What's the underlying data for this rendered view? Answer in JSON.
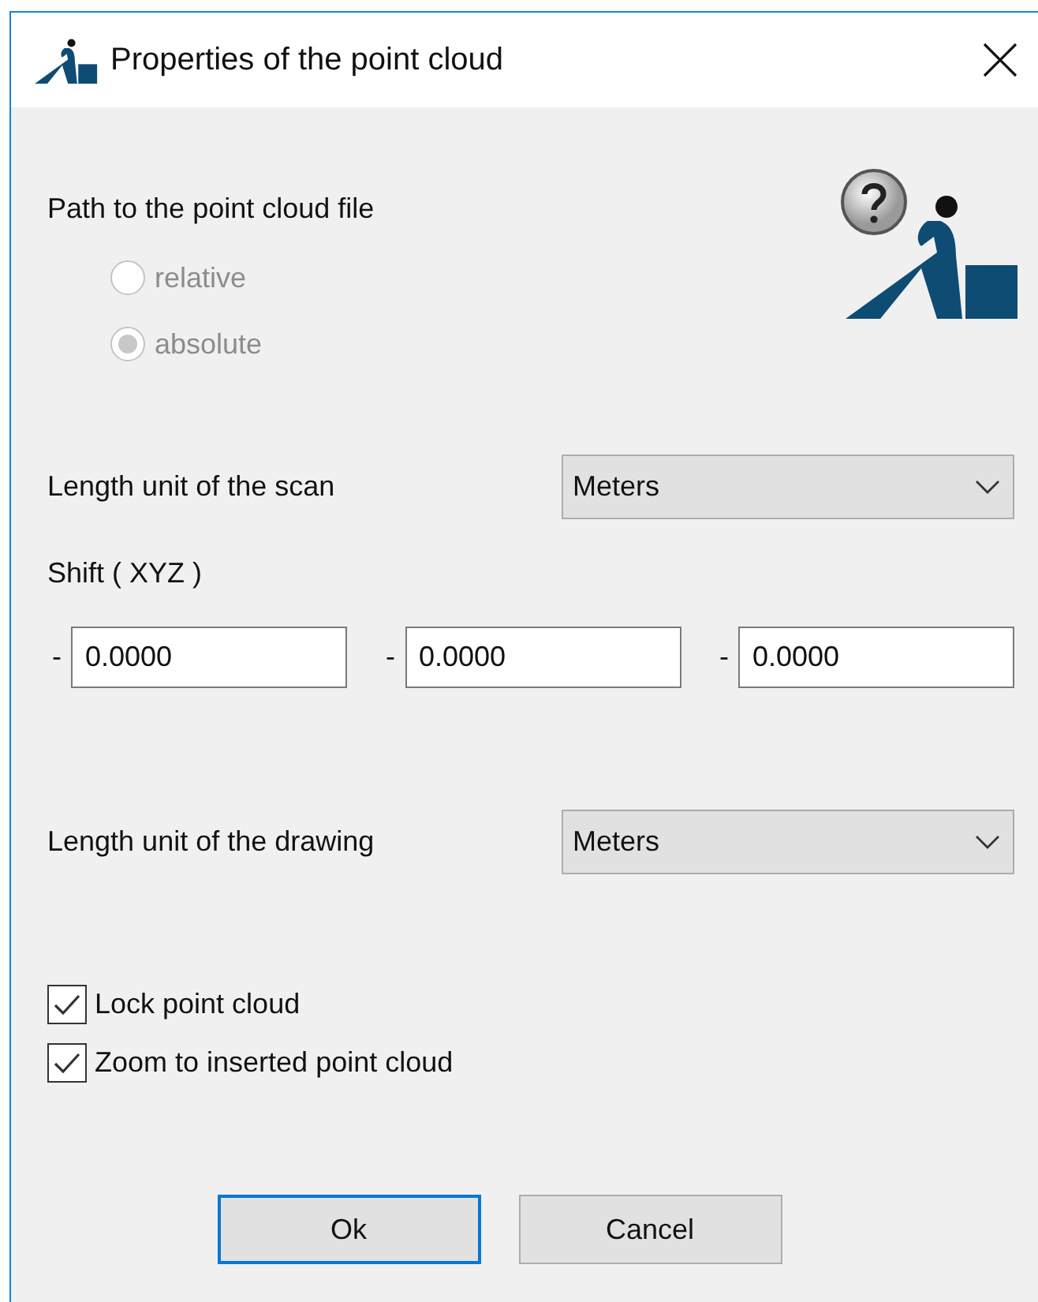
{
  "window": {
    "title": "Properties of the point cloud"
  },
  "path": {
    "label": "Path to the point cloud file",
    "options": [
      {
        "label": "relative",
        "selected": false,
        "disabled": true
      },
      {
        "label": "absolute",
        "selected": true,
        "disabled": true
      }
    ]
  },
  "scan_unit": {
    "label": "Length unit of the scan",
    "value": "Meters"
  },
  "shift": {
    "label": "Shift ( XYZ )",
    "fields": [
      {
        "prefix": "-",
        "value": "0.0000"
      },
      {
        "prefix": "-",
        "value": "0.0000"
      },
      {
        "prefix": "-",
        "value": "0.0000"
      }
    ]
  },
  "drawing_unit": {
    "label": "Length unit of the drawing",
    "value": "Meters"
  },
  "checkboxes": [
    {
      "label": "Lock point cloud",
      "checked": true
    },
    {
      "label": "Zoom to inserted point cloud",
      "checked": true
    }
  ],
  "buttons": [
    {
      "label": "Ok",
      "default": true
    },
    {
      "label": "Cancel",
      "default": false
    }
  ]
}
